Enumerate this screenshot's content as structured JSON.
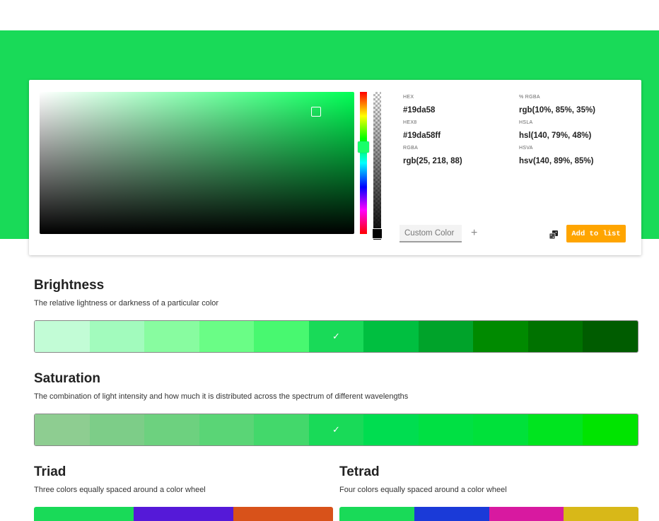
{
  "hex": {
    "label": "HEX",
    "value": "#19da58"
  },
  "hex8": {
    "label": "HEX8",
    "value": "#19da58ff"
  },
  "rgba": {
    "label": "RGBA",
    "value": "rgb(25, 218, 88)"
  },
  "percent_rgba": {
    "label": "% RGBA",
    "value": "rgb(10%, 85%, 35%)"
  },
  "hsla": {
    "label": "HSLA",
    "value": "hsl(140, 79%, 48%)"
  },
  "hsva": {
    "label": "HSVA",
    "value": "hsv(140, 89%, 85%)"
  },
  "custom_color": {
    "placeholder": "Custom Color"
  },
  "plus_glyph": "+",
  "add_button": "Add to list",
  "checkmark": "✓",
  "brightness": {
    "title": "Brightness",
    "description": "The relative lightness or darkness of a particular color",
    "swatches": [
      "#c2fcd6",
      "#a2fbbd",
      "#88fca0",
      "#6afd86",
      "#48f870",
      "#19da58",
      "#00bf40",
      "#00a32a",
      "#008a00",
      "#007200",
      "#005c00"
    ],
    "selected_index": 5
  },
  "saturation": {
    "title": "Saturation",
    "description": "The combination of light intensity and how much it is distributed across the spectrum of different wavelengths",
    "swatches": [
      "#8ecd91",
      "#7dcd88",
      "#6dd17f",
      "#5ad576",
      "#43d86b",
      "#19da58",
      "#00dd50",
      "#00e043",
      "#00e13a",
      "#00e41f",
      "#00e400"
    ],
    "selected_index": 5
  },
  "triad": {
    "title": "Triad",
    "description": "Three colors equally spaced around a color wheel",
    "swatches": [
      "#19da58",
      "#5519d8",
      "#d8521a"
    ]
  },
  "tetrad": {
    "title": "Tetrad",
    "description": "Four colors equally spaced around a color wheel",
    "swatches": [
      "#19da58",
      "#1a3ad8",
      "#d819a0",
      "#d8b818"
    ]
  }
}
